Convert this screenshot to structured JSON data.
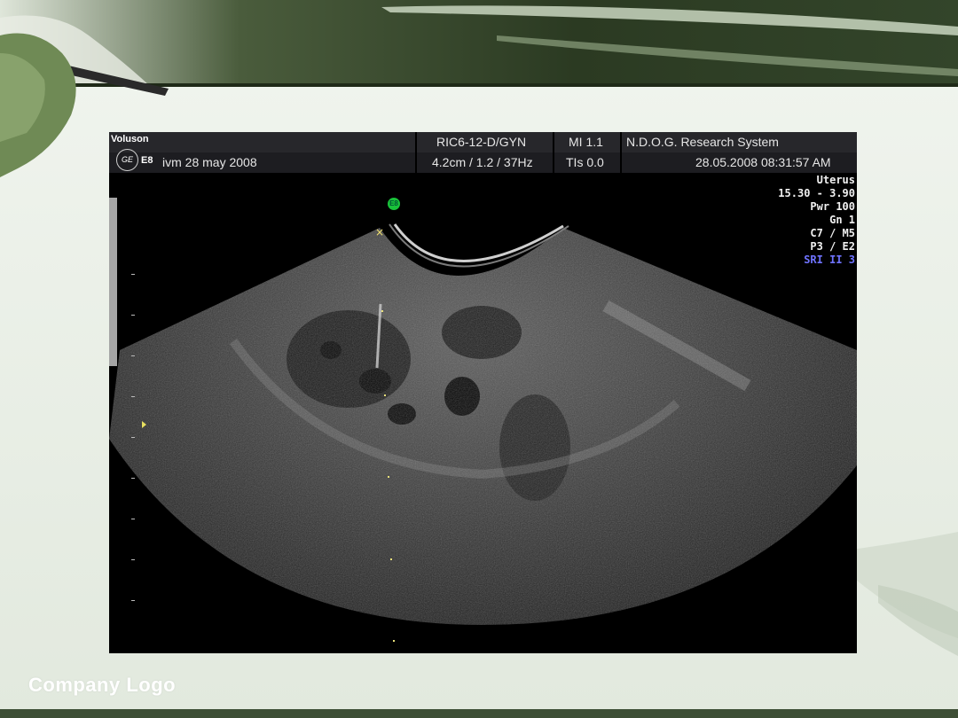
{
  "ultrasound": {
    "brand": "Voluson",
    "model": "E8",
    "logo_text": "GE",
    "probe": "RIC6-12-D/GYN",
    "mi": "MI  1.1",
    "institution": "N.D.O.G. Research System",
    "patient": "ivm 28 may 2008",
    "depth_freq": "4.2cm / 1.2 / 37Hz",
    "tis": "TIs  0.0",
    "datetime": "28.05.2008  08:31:57 AM",
    "badge": "E8",
    "info_lines": [
      "Uterus",
      "15.30 - 3.90",
      "Pwr 100",
      "Gn  1",
      "C7 / M5",
      "P3 / E2"
    ],
    "info_highlight": "SRI II 3"
  },
  "footer": {
    "company_logo": "Company  Logo"
  },
  "colors": {
    "header_green": "#2f4026",
    "info_blue": "#6f73ff",
    "badge_green": "#19c23a"
  }
}
